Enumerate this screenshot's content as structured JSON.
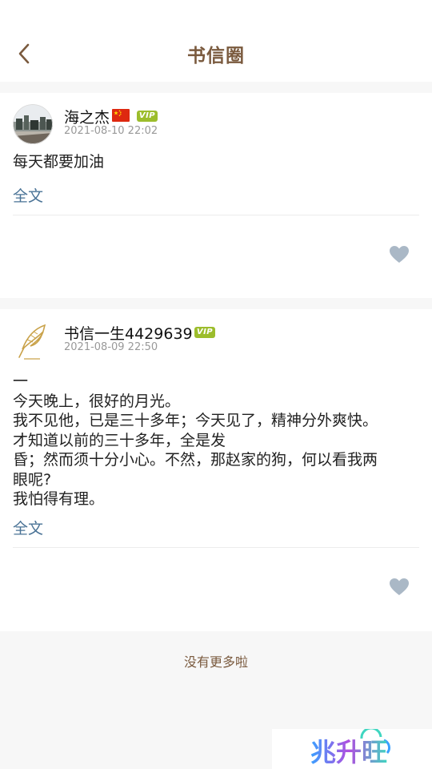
{
  "header": {
    "title": "书信圈",
    "back_icon": "chevron-left-icon"
  },
  "posts": [
    {
      "username": "海之杰",
      "flag_icon": "china-flag-icon",
      "vip_badge": "VIP",
      "time": "2021-08-10 22:02",
      "content_lines": [
        "每天都要加油"
      ],
      "fulltext_label": "全文",
      "like_icon": "heart-icon"
    },
    {
      "username": "书信一生4429639",
      "vip_badge": "VIP",
      "time": "2021-08-09 22:50",
      "content_lines": [
        "一",
        "今天晚上，很好的月光。",
        "我不见他，已是三十多年；今天见了，精神分外爽快。",
        "才知道以前的三十多年，全是发",
        "昏；然而须十分小心。不然，那赵家的狗，何以看我两",
        "眼呢?",
        "我怕得有理。"
      ],
      "fulltext_label": "全文",
      "like_icon": "heart-icon"
    }
  ],
  "footer": {
    "no_more": "没有更多啦"
  },
  "watermark": {
    "text": "兆升旺"
  },
  "colors": {
    "title": "#7a5a3e",
    "link": "#4a7396",
    "vip": "#9cbd2c",
    "heart": "#aab8c6",
    "background": "#f7f7f7"
  }
}
